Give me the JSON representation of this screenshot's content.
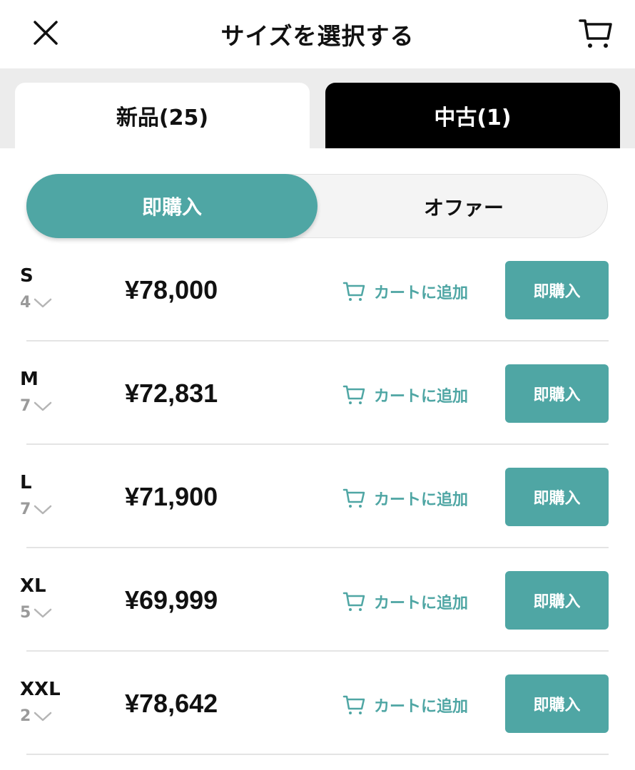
{
  "header": {
    "title": "サイズを選択する",
    "close_icon": "close-icon",
    "cart_icon": "cart-icon"
  },
  "tabs": {
    "new_label": "新品(25)",
    "used_label": "中古(1)"
  },
  "segment": {
    "buy_now_label": "即購入",
    "offer_label": "オファー"
  },
  "colors": {
    "accent": "#4fa6a4",
    "dark_tab": "#000000",
    "tab_bg": "#ececec"
  },
  "rows": [
    {
      "size": "S",
      "count": "4",
      "price": "¥78,000",
      "add_cart_label": "カートに追加",
      "buy_label": "即購入"
    },
    {
      "size": "M",
      "count": "7",
      "price": "¥72,831",
      "add_cart_label": "カートに追加",
      "buy_label": "即購入"
    },
    {
      "size": "L",
      "count": "7",
      "price": "¥71,900",
      "add_cart_label": "カートに追加",
      "buy_label": "即購入"
    },
    {
      "size": "XL",
      "count": "5",
      "price": "¥69,999",
      "add_cart_label": "カートに追加",
      "buy_label": "即購入"
    },
    {
      "size": "XXL",
      "count": "2",
      "price": "¥78,642",
      "add_cart_label": "カートに追加",
      "buy_label": "即購入"
    }
  ]
}
